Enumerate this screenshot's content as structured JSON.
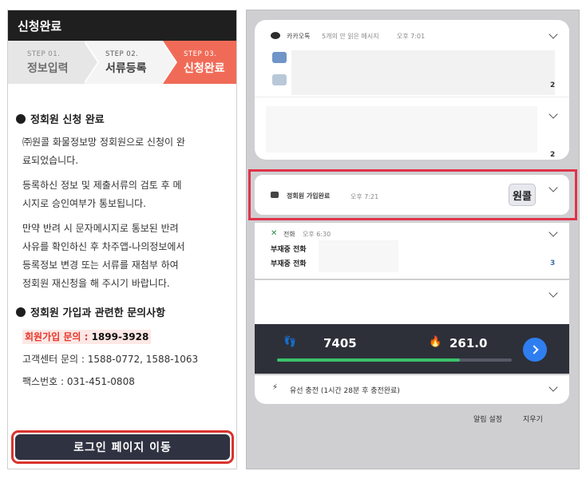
{
  "left_panel": {
    "header_title": "신청완료",
    "steps": [
      {
        "small": "STEP 01.",
        "label": "정보입력"
      },
      {
        "small": "STEP 02.",
        "label": "서류등록"
      },
      {
        "small": "STEP 03.",
        "label": "신청완료"
      }
    ],
    "section1": {
      "title": "정회원 신청 완료",
      "paragraphs": [
        [
          "㈜원콜 화물정보망 정회원으로 신청이 완",
          "료되었습니다."
        ],
        [
          "등록하신 정보 및 제출서류의 검토 후 메",
          "시지로 승인여부가 통보됩니다."
        ],
        [
          "만약 반려 시 문자메시지로 통보된 반려",
          "사유를 확인하신 후 차주앱-나의정보에서",
          "등록정보 변경 또는 서류를 재첨부 하여",
          "정회원 재신청을 해 주시기 바랍니다."
        ]
      ]
    },
    "section2": {
      "title": "정회원 가입과 관련한 문의사항",
      "signup_label": "회원가입 문의 : ",
      "signup_number": "1899-3928",
      "customer_center": "고객센터 문의 : 1588-0772, 1588-1063",
      "fax": "팩스번호 : 031-451-0808"
    },
    "login_button": "로그인 페이지 이동"
  },
  "right_panel": {
    "kakao": {
      "app": "카카오톡",
      "info": "5개의 안 읽은 메시지",
      "time": "오후 7:01",
      "count": "2"
    },
    "card2": {
      "count": "2"
    },
    "wongol": {
      "title": "정회원 가입완료",
      "time": "오후 7:21",
      "logo_text": "원콜"
    },
    "call": {
      "app": "전화",
      "time": "오후 6:30",
      "items": [
        "부재중 전화",
        "부재중 전화"
      ],
      "count": "3"
    },
    "steps_widget": {
      "steps": "7405",
      "calories": "261.0",
      "progress": 0.78
    },
    "charging": {
      "text": "유선 충전 (1시간 28분 후 충전완료)"
    },
    "footer": {
      "settings": "알림 설정",
      "clear": "지우기"
    }
  },
  "colors": {
    "header_bg": "#1f1f1f",
    "step_active": "#f06b57",
    "highlight_red": "#e0334a",
    "login_button_bg": "#2f3241",
    "progress_green": "#3ac26a",
    "go_button_blue": "#2f7ef0"
  }
}
